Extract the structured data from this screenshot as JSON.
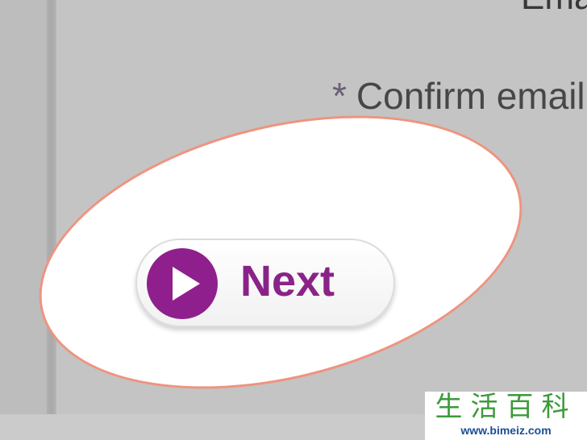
{
  "form": {
    "email_label_partial": "Email",
    "confirm_required_mark": "*",
    "confirm_label": "Confirm email"
  },
  "button": {
    "label": "Next",
    "icon": "play-icon"
  },
  "watermark": {
    "cn": "生活百科",
    "url": "www.bimeiz.com"
  },
  "colors": {
    "page_bg": "#c4c4c4",
    "spotlight_border": "#ee9480",
    "accent_purple": "#8f1f8c",
    "watermark_green": "#3c9a3a",
    "watermark_blue": "#1b4e93"
  }
}
